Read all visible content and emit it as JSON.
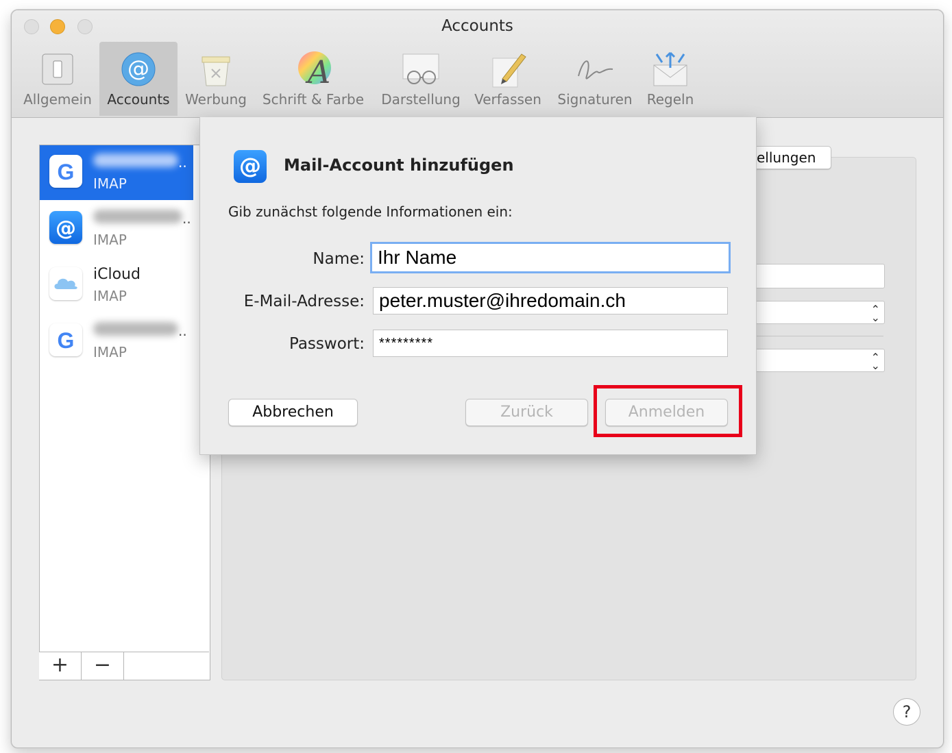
{
  "window": {
    "title": "Accounts"
  },
  "toolbar": {
    "items": [
      {
        "label": "Allgemein",
        "icon": "switch-icon"
      },
      {
        "label": "Accounts",
        "icon": "at-icon"
      },
      {
        "label": "Werbung",
        "icon": "junk-bin-icon"
      },
      {
        "label": "Schrift & Farbe",
        "icon": "font-color-icon"
      },
      {
        "label": "Darstellung",
        "icon": "glasses-icon"
      },
      {
        "label": "Verfassen",
        "icon": "pencil-icon"
      },
      {
        "label": "Signaturen",
        "icon": "signature-icon"
      },
      {
        "label": "Regeln",
        "icon": "rules-envelope-icon"
      }
    ]
  },
  "accounts": [
    {
      "type": "IMAP",
      "icon": "google-icon",
      "selected": true
    },
    {
      "type": "IMAP",
      "icon": "at-icon"
    },
    {
      "name": "iCloud",
      "type": "IMAP",
      "icon": "icloud-icon"
    },
    {
      "type": "IMAP",
      "icon": "google-icon"
    }
  ],
  "list_controls": {
    "add": "+",
    "remove": "−"
  },
  "detail": {
    "tab_partial": "ellungen"
  },
  "sheet": {
    "title": "Mail-Account hinzufügen",
    "subtitle": "Gib zunächst folgende Informationen ein:",
    "fields": {
      "name_label": "Name:",
      "name_value": "Ihr Name",
      "email_label": "E-Mail-Adresse:",
      "email_value": "peter.muster@ihredomain.ch",
      "password_label": "Passwort:",
      "password_value": "*********"
    },
    "buttons": {
      "cancel": "Abbrechen",
      "back": "Zurück",
      "login": "Anmelden"
    }
  },
  "help": "?",
  "colors": {
    "selection": "#1f6fe8",
    "highlight": "#e8001a",
    "focus_ring": "#79aef2"
  }
}
